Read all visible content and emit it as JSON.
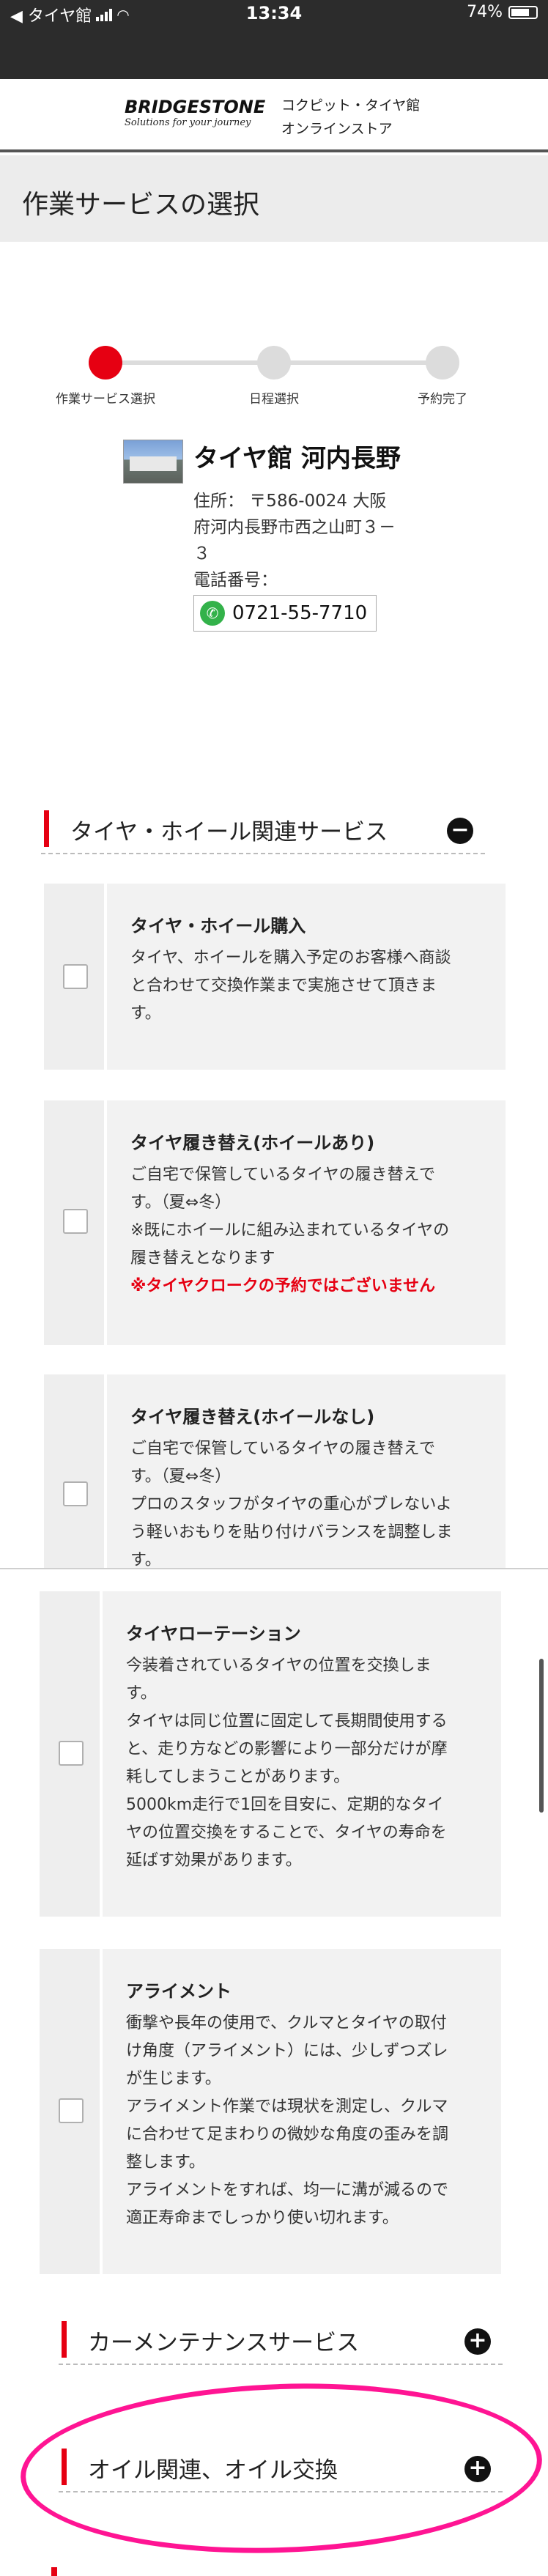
{
  "status_bar": {
    "back_app": "◀ タイヤ館",
    "time": "13:34",
    "battery": "74%",
    "battery_level": 0.74
  },
  "brand": {
    "name": "BRIDGESTONE",
    "tagline": "Solutions for your journey",
    "store_line1": "コクピット・タイヤ館",
    "store_line2": "オンラインストア"
  },
  "page": {
    "title": "作業サービスの選択"
  },
  "stepper": {
    "steps": [
      {
        "label": "作業サービス選択",
        "active": true
      },
      {
        "label": "日程選択",
        "active": false
      },
      {
        "label": "予約完了",
        "active": false
      }
    ]
  },
  "shop": {
    "name": "タイヤ館 河内長野",
    "address_lines": [
      "住所： 〒586-0024 大阪",
      "府河内長野市西之山町３－",
      "３"
    ],
    "phone_label": "電話番号：",
    "phone": "0721-55-7710"
  },
  "categories": [
    {
      "title": "タイヤ・ホイール関連サービス",
      "expanded": true,
      "toggle": "−",
      "services": [
        {
          "title": "タイヤ・ホイール購入",
          "desc": [
            "タイヤ、ホイールを購入予定のお客様へ商談",
            "と合わせて交換作業まで実施させて頂きま",
            "す。"
          ],
          "note": ""
        },
        {
          "title": "タイヤ履き替え(ホイールあり)",
          "desc": [
            "ご自宅で保管しているタイヤの履き替えで",
            "す。（夏⇔冬）",
            "※既にホイールに組み込まれているタイヤの",
            "履き替えとなります"
          ],
          "note": "※タイヤクロークの予約ではございません"
        },
        {
          "title": "タイヤ履き替え(ホイールなし)",
          "desc": [
            "ご自宅で保管しているタイヤの履き替えで",
            "す。（夏⇔冬）",
            "プロのスタッフがタイヤの重心がブレないよ",
            "う軽いおもりを貼り付けバランスを調整しま",
            "す。"
          ],
          "note": ""
        },
        {
          "title": "タイヤローテーション",
          "desc": [
            "今装着されているタイヤの位置を交換しま",
            "す。",
            "タイヤは同じ位置に固定して長期間使用する",
            "と、走り方などの影響により一部分だけが摩",
            "耗してしまうことがあります。",
            "5000km走行で1回を目安に、定期的なタイ",
            "ヤの位置交換をすることで、タイヤの寿命を",
            "延ばす効果があります。"
          ],
          "note": ""
        },
        {
          "title": "アライメント",
          "desc": [
            "衝撃や長年の使用で、クルマとタイヤの取付",
            "け角度（アライメント）には、少しずつズレ",
            "が生じます。",
            "アライメント作業では現状を測定し、クルマ",
            "に合わせて足まわりの微妙な角度の歪みを調",
            "整します。",
            "アライメントをすれば、均一に溝が減るので",
            "適正寿命までしっかり使い切れます。"
          ],
          "note": ""
        }
      ]
    },
    {
      "title": "カーメンテナンスサービス",
      "expanded": false,
      "toggle": "+"
    },
    {
      "title": "オイル関連、オイル交換",
      "expanded": false,
      "toggle": "+"
    }
  ],
  "colors": {
    "accent": "#e60012",
    "annotation": "#ff1493",
    "header_dark": "#2c2c2c",
    "phone_green": "#33b24a"
  }
}
